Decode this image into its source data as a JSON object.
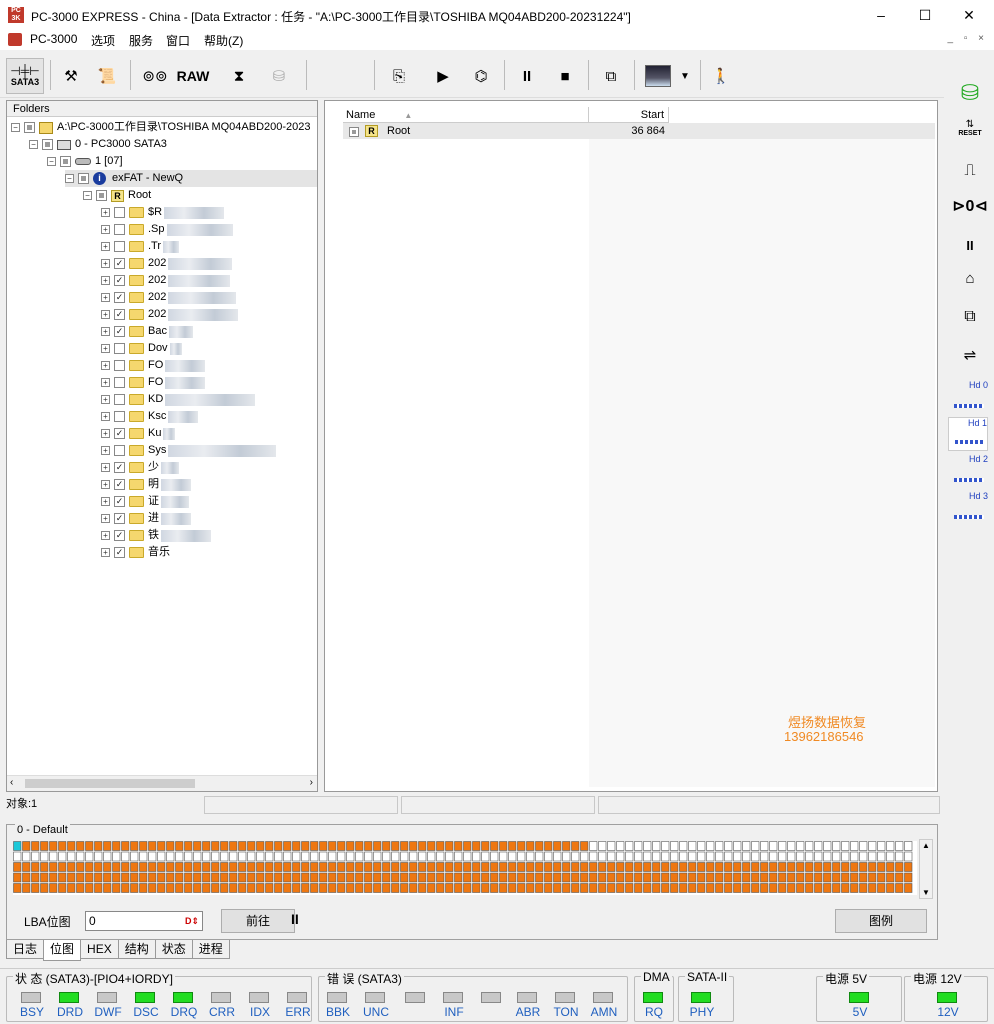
{
  "window": {
    "title": "PC-3000 EXPRESS - China - [Data Extractor : 任务 - \"A:\\PC-3000工作目录\\TOSHIBA MQ04ABD200-20231224\"]",
    "app_icon_text": "PC 3K",
    "controls": {
      "minimize": "–",
      "maximize": "☐",
      "close": "✕"
    }
  },
  "menubar": {
    "items": [
      "PC-3000",
      "选项",
      "服务",
      "窗口",
      "帮助(Z)"
    ],
    "mdi_controls": "_ ▫ ×"
  },
  "toolbar": {
    "sata_label": "SATA3",
    "raw_label": "RAW"
  },
  "folders": {
    "header": "Folders",
    "path_node": "A:\\PC-3000工作目录\\TOSHIBA MQ04ABD200-2023",
    "device_node": "0 - PC3000 SATA3",
    "partition_node": "1 [07]",
    "fs_node": "exFAT - NewQ",
    "root_node": "Root",
    "root_icon": "R",
    "children": [
      {
        "label": "$R",
        "checked": false
      },
      {
        "label": ".Sp",
        "checked": false
      },
      {
        "label": ".Tr",
        "checked": false
      },
      {
        "label": "202",
        "checked": true
      },
      {
        "label": "202",
        "checked": true
      },
      {
        "label": "202",
        "checked": true
      },
      {
        "label": "202",
        "checked": true
      },
      {
        "label": "Bac",
        "checked": true
      },
      {
        "label": "Dov",
        "checked": false
      },
      {
        "label": "FO",
        "checked": false
      },
      {
        "label": "FO",
        "checked": false
      },
      {
        "label": "KD",
        "checked": false
      },
      {
        "label": "Ksc",
        "checked": false
      },
      {
        "label": "Ku",
        "checked": true
      },
      {
        "label": "Sys",
        "checked": false
      },
      {
        "label": "少",
        "checked": true
      },
      {
        "label": "明",
        "checked": true
      },
      {
        "label": "证",
        "checked": true
      },
      {
        "label": "进",
        "checked": true
      },
      {
        "label": "铁",
        "checked": true
      },
      {
        "label": "音乐",
        "checked": true
      }
    ]
  },
  "filelist": {
    "col_name": "Name",
    "col_start": "Start",
    "sort_indicator": "▲",
    "rows": [
      {
        "name": "Root",
        "start": "36 864",
        "icon": "R"
      }
    ]
  },
  "watermark": {
    "line1": "煜扬数据恢复",
    "line2": "13962186546"
  },
  "status": {
    "objects": "对象:1"
  },
  "bitmap": {
    "title": "0 - Default",
    "lba_label": "LBA位图",
    "lba_value": "0",
    "goto_label": "前往",
    "pause": "II",
    "legend_label": "图例",
    "row1_filled_fraction": 0.64,
    "fill_color": "#ee7711"
  },
  "bottom_tabs": [
    "日志",
    "位图",
    "HEX",
    "结构",
    "状态",
    "进程"
  ],
  "bottom_tabs_active": 1,
  "indicators": {
    "status_group": {
      "title": "状 态 (SATA3)-[PIO4+IORDY]",
      "leds": [
        {
          "label": "BSY",
          "on": false
        },
        {
          "label": "DRD",
          "on": true
        },
        {
          "label": "DWF",
          "on": false
        },
        {
          "label": "DSC",
          "on": true
        },
        {
          "label": "DRQ",
          "on": true
        },
        {
          "label": "CRR",
          "on": false
        },
        {
          "label": "IDX",
          "on": false
        },
        {
          "label": "ERR",
          "on": false
        }
      ]
    },
    "error_group": {
      "title": "错 误 (SATA3)",
      "leds": [
        {
          "label": "BBK",
          "on": false
        },
        {
          "label": "UNC",
          "on": false
        },
        {
          "label": "",
          "on": false
        },
        {
          "label": "INF",
          "on": false
        },
        {
          "label": "",
          "on": false
        },
        {
          "label": "ABR",
          "on": false
        },
        {
          "label": "TON",
          "on": false
        },
        {
          "label": "AMN",
          "on": false
        }
      ]
    },
    "dma_group": {
      "title": "DMA",
      "leds": [
        {
          "label": "RQ",
          "on": true
        }
      ]
    },
    "sata_group": {
      "title": "SATA-II",
      "leds": [
        {
          "label": "PHY",
          "on": true
        }
      ]
    },
    "power5_group": {
      "title": "电源 5V",
      "leds": [
        {
          "label": "5V",
          "on": true
        }
      ]
    },
    "power12_group": {
      "title": "电源 12V",
      "leds": [
        {
          "label": "12V",
          "on": true
        }
      ]
    }
  },
  "rightbar": {
    "reset_label": "RESET",
    "hd_labels": [
      "Hd 0",
      "Hd 1",
      "Hd 2",
      "Hd 3"
    ],
    "hd_active": 1
  }
}
